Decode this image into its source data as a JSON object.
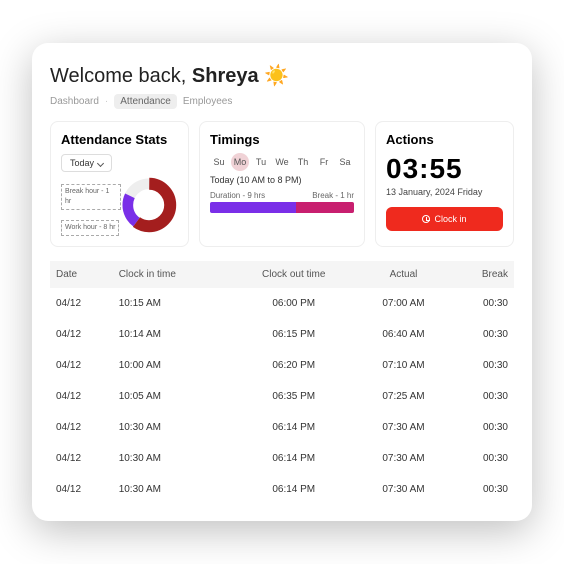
{
  "welcome": {
    "prefix": "Welcome back, ",
    "name": "Shreya",
    "emoji": "☀️"
  },
  "breadcrumb": {
    "items": [
      "Dashboard",
      "Attendance",
      "Employees"
    ],
    "active_index": 1
  },
  "stats": {
    "title": "Attendance Stats",
    "period_label": "Today",
    "legend_break": "Break hour - 1 hr",
    "legend_work": "Work hour - 8 hr"
  },
  "timings": {
    "title": "Timings",
    "days": [
      "Su",
      "Mo",
      "Tu",
      "We",
      "Th",
      "Fr",
      "Sa"
    ],
    "selected_day_index": 1,
    "today_label": "Today (10 AM to 8 PM)",
    "duration_label": "Duration - 9 hrs",
    "break_label": "Break - 1 hr"
  },
  "actions": {
    "title": "Actions",
    "clock": "03:55",
    "date": "13 January, 2024  Friday",
    "button": "Clock in"
  },
  "table": {
    "headers": [
      "Date",
      "Clock in time",
      "Clock out time",
      "Actual",
      "Break"
    ],
    "rows": [
      [
        "04/12",
        "10:15 AM",
        "06:00 PM",
        "07:00 AM",
        "00:30"
      ],
      [
        "04/12",
        "10:14 AM",
        "06:15 PM",
        "06:40 AM",
        "00:30"
      ],
      [
        "04/12",
        "10:00 AM",
        "06:20 PM",
        "07:10 AM",
        "00:30"
      ],
      [
        "04/12",
        "10:05 AM",
        "06:35 PM",
        "07:25 AM",
        "00:30"
      ],
      [
        "04/12",
        "10:30 AM",
        "06:14 PM",
        "07:30 AM",
        "00:30"
      ],
      [
        "04/12",
        "10:30 AM",
        "06:14 PM",
        "07:30 AM",
        "00:30"
      ],
      [
        "04/12",
        "10:30 AM",
        "06:14 PM",
        "07:30 AM",
        "00:30"
      ]
    ]
  },
  "chart_data": {
    "type": "pie",
    "title": "Attendance Stats",
    "series": [
      {
        "name": "Work hour",
        "value": 8,
        "color": "#a41e1e"
      },
      {
        "name": "Break hour",
        "value": 1,
        "color": "#7a2fe8"
      }
    ]
  }
}
